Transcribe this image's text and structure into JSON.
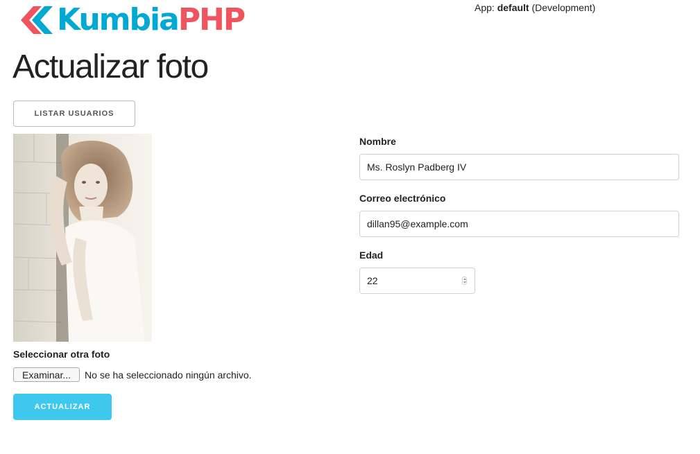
{
  "header": {
    "logo_kumbia": "Kumbia",
    "logo_php": "PHP",
    "app_prefix": "App:",
    "app_name": "default",
    "app_env": "(Development)"
  },
  "page": {
    "title": "Actualizar foto"
  },
  "actions": {
    "list_users_label": "LISTAR USUARIOS",
    "update_label": "ACTUALIZAR"
  },
  "photo": {
    "alt": "Foto de usuario"
  },
  "file_input": {
    "label": "Seleccionar otra foto",
    "button_label": "Examinar...",
    "status": "No se ha seleccionado ningún archivo."
  },
  "form": {
    "name_label": "Nombre",
    "name_value": "Ms. Roslyn Padberg IV",
    "email_label": "Correo electrónico",
    "email_value": "dillan95@example.com",
    "age_label": "Edad",
    "age_value": "22"
  },
  "colors": {
    "brand_blue": "#00a9d4",
    "brand_red": "#f0545f",
    "primary_button": "#3fc8ef"
  }
}
